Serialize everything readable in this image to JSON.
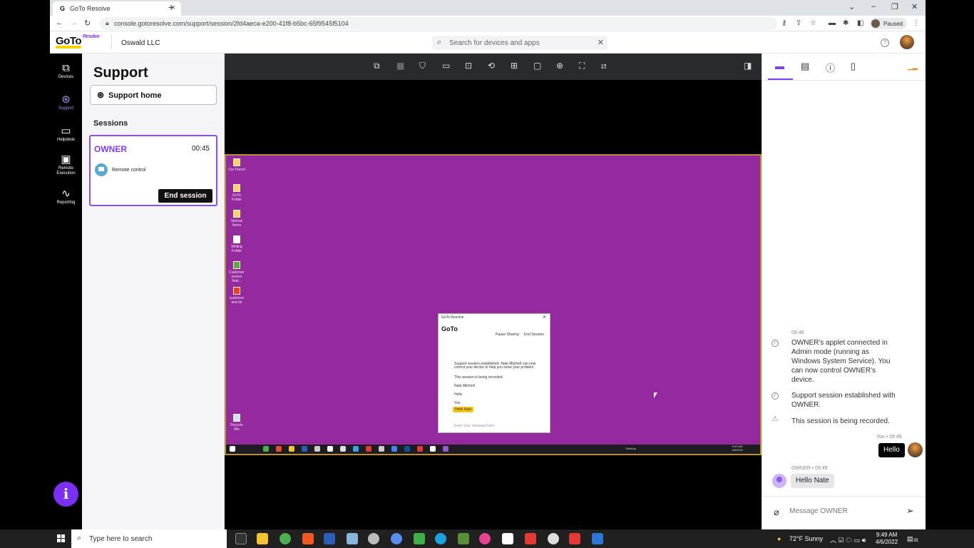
{
  "browser": {
    "tab_title": "GoTo Resolve",
    "tab_icon": "goto-favicon-icon",
    "url": "console.gotoresolve.com/support/session/2fd4aeca-e200-41f8-b5bc-65f9545f5104",
    "profile_status": "Paused",
    "colors": {
      "tabstrip": "#dee1e6",
      "omnibox": "#f1f3f4"
    }
  },
  "header": {
    "logo_text": "GoTo",
    "logo_product": "Resolve",
    "org_name": "Oswald LLC",
    "search_placeholder": "Search for devices and apps",
    "colors": {
      "brand_purple": "#7e3ff2",
      "brand_yellow": "#f5d200"
    }
  },
  "nav": {
    "items": [
      {
        "label": "Devices",
        "icon": "devices-icon"
      },
      {
        "label": "Support",
        "icon": "support-lifebuoy-icon",
        "active": true
      },
      {
        "label": "Helpdesk",
        "icon": "helpdesk-ticket-icon"
      },
      {
        "label": "Remote Execution",
        "icon": "remote-execution-icon"
      },
      {
        "label": "Reporting",
        "icon": "reporting-chart-icon"
      }
    ],
    "info_button": "i"
  },
  "support": {
    "title": "Support",
    "home_button": "Support home",
    "sessions_label": "Sessions",
    "session": {
      "name": "OWNER",
      "duration": "00:45",
      "mode": "Remote control",
      "end_button": "End session"
    }
  },
  "viewer": {
    "toolbar_icons": [
      "switch-monitor-icon",
      "multi-monitor-icon",
      "shield-icon",
      "keyboard-icon",
      "screen-share-icon",
      "ctrl-alt-del-icon",
      "remote-screen-icon",
      "display-icon",
      "zoom-in-icon",
      "fullscreen-icon",
      "disable-input-icon",
      "side-panel-icon"
    ],
    "remote_desktop_color": "#952a9e",
    "desktop_icons": [
      "Car Parcel",
      "GoTo Folder",
      "Various Items",
      "Writing Folder",
      "Customer screen final...",
      "customer test.txt",
      "Recycle Bin"
    ],
    "mini_window": {
      "title": "GoTo Resolve",
      "pause_label": "Pause Sharing",
      "end_label": "End Session",
      "msg1": "Support session established. Nate Mitchell can now control your device to help you solve your problem.",
      "msg2": "This session is being recorded.",
      "sender": "Nate Mitchell",
      "sender_msg": "Hello",
      "you_label": "You",
      "you_msg": "Hello Nate",
      "input_placeholder": "Enter your message here"
    },
    "remote_taskbar": {
      "desktop_label": "Desktop",
      "time": "9:49 AM",
      "date": "4/6/2022"
    }
  },
  "chat": {
    "tabs": [
      "chat-icon",
      "files-icon",
      "info-icon",
      "notes-icon",
      "signal-icon"
    ],
    "system_time": "09:48",
    "system_messages": [
      "OWNER's applet connected in Admin mode (running as Windows System Service). You can now control OWNER's device.",
      "Support session established with OWNER.",
      "This session is being recorded."
    ],
    "me_meta": "You • 09:49",
    "me_message": "Hello",
    "other_meta": "OWNER • 09:49",
    "other_message": "Hello Nate",
    "input_placeholder": "Message OWNER"
  },
  "taskbar": {
    "search_placeholder": "Type here to search",
    "weather": "72°F  Sunny",
    "time": "9:49 AM",
    "date": "4/6/2022",
    "notification_count": "35"
  }
}
